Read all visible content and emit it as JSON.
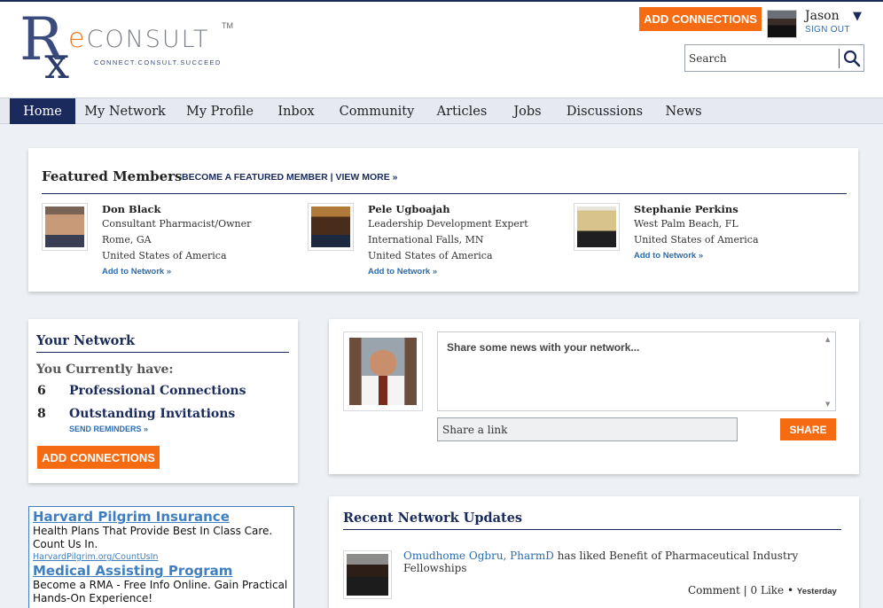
{
  "brand": {
    "logo_r": "R",
    "logo_x": "x",
    "logo_e": "e",
    "logo_word": "CONSULT",
    "trademark": "TM",
    "tagline": "Connect.Consult.Succeed"
  },
  "header": {
    "add_connections_label": "ADD CONNECTIONS",
    "user_name": "Jason",
    "sign_out_label": "SIGN OUT",
    "caret": "▼",
    "search_placeholder": "Search"
  },
  "nav": {
    "items": [
      {
        "label": "Home",
        "active": true
      },
      {
        "label": "My Network"
      },
      {
        "label": "My Profile"
      },
      {
        "label": "Inbox"
      },
      {
        "label": "Community"
      },
      {
        "label": "Articles"
      },
      {
        "label": "Jobs"
      },
      {
        "label": "Discussions"
      },
      {
        "label": "News"
      }
    ]
  },
  "featured": {
    "title": "Featured Members",
    "links": "BECOME A FEATURED MEMBER | VIEW MORE »",
    "members": [
      {
        "name": "Don Black",
        "title": "Consultant Pharmacist/Owner",
        "city": "Rome, GA",
        "country": "United States of America",
        "add_label": "Add to Network »"
      },
      {
        "name": "Pele Ugboajah",
        "title": "Leadership Development Expert",
        "city": "International Falls, MN",
        "country": "United States of America",
        "add_label": "Add to Network »"
      },
      {
        "name": "Stephanie Perkins",
        "city": "West Palm Beach, FL",
        "country": "United States of America",
        "add_label": "Add to Network »"
      }
    ]
  },
  "your_network": {
    "title": "Your Network",
    "have_label": "You Currently have:",
    "professional_count": "6",
    "professional_label": "Professional Connections",
    "invitations_count": "8",
    "invitations_label": "Outstanding Invitations",
    "send_reminders_label": "SEND REMINDERS »",
    "add_connections_label": "ADD CONNECTIONS"
  },
  "share": {
    "news_placeholder": "Share some news with your network...",
    "link_placeholder": "Share a link",
    "share_label": "SHARE",
    "scroll_up": "▲",
    "scroll_down": "▼"
  },
  "ads": [
    {
      "title": "Harvard Pilgrim Insurance",
      "body": "Health Plans That Provide Best In Class Care. Count Us In.",
      "url": "HarvardPilgrim.org/CountUsIn"
    },
    {
      "title": "Medical Assisting Program",
      "body": "Become a RMA - Free Info Online. Gain Practical Hands-On Experience!",
      "url": ""
    }
  ],
  "updates": {
    "title": "Recent Network Updates",
    "item": {
      "who": "Omudhome Ogbru, PharmD",
      "action": " has liked Benefit of Pharmaceutical Industry Fellowships",
      "comment_label": "Comment",
      "separator": "|",
      "like_label": "0 Like",
      "bullet": "•",
      "when": "Yesterday"
    }
  }
}
